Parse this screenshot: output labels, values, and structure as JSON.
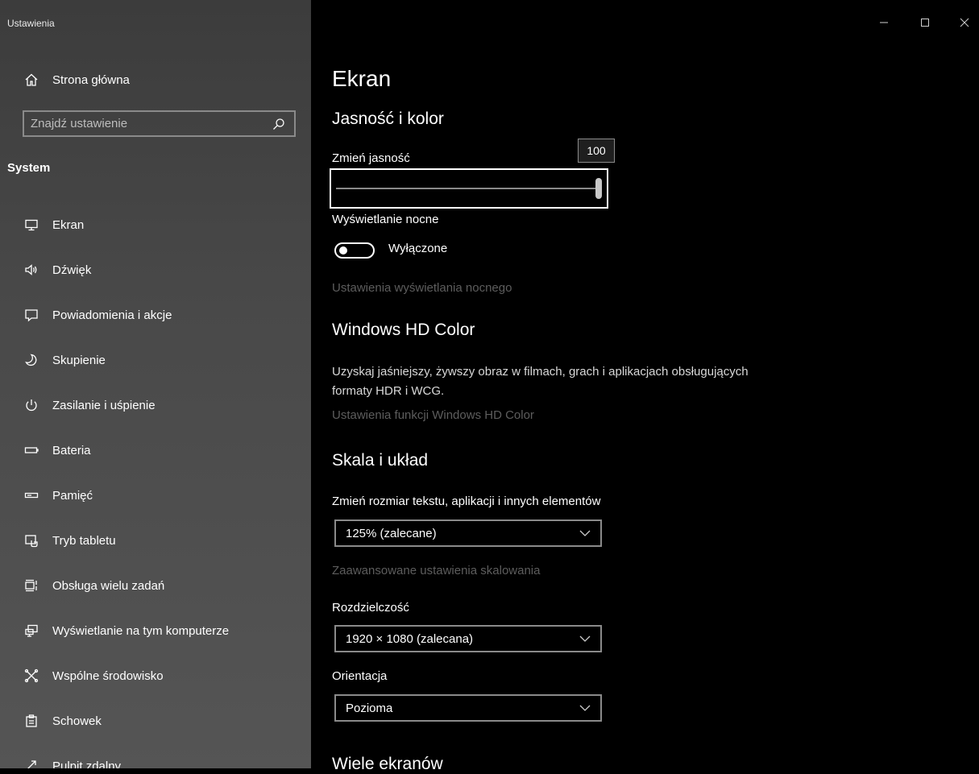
{
  "window": {
    "title": "Ustawienia"
  },
  "sidebar": {
    "home_label": "Strona główna",
    "search_placeholder": "Znajdź ustawienie",
    "section_title": "System",
    "items": [
      {
        "label": "Ekran",
        "icon": "monitor-icon"
      },
      {
        "label": "Dźwięk",
        "icon": "speaker-icon"
      },
      {
        "label": "Powiadomienia i akcje",
        "icon": "notification-icon"
      },
      {
        "label": "Skupienie",
        "icon": "moon-icon"
      },
      {
        "label": "Zasilanie i uśpienie",
        "icon": "power-icon"
      },
      {
        "label": "Bateria",
        "icon": "battery-icon"
      },
      {
        "label": "Pamięć",
        "icon": "storage-icon"
      },
      {
        "label": "Tryb tabletu",
        "icon": "tablet-mode-icon"
      },
      {
        "label": "Obsługa wielu zadań",
        "icon": "multitasking-icon"
      },
      {
        "label": "Wyświetlanie na tym komputerze",
        "icon": "project-icon"
      },
      {
        "label": "Wspólne środowisko",
        "icon": "shared-experiences-icon"
      },
      {
        "label": "Schowek",
        "icon": "clipboard-icon"
      },
      {
        "label": "Pulpit zdalny",
        "icon": "remote-desktop-icon"
      }
    ]
  },
  "main": {
    "page_title": "Ekran",
    "brightness": {
      "heading": "Jasność i kolor",
      "label": "Zmień jasność",
      "value": "100",
      "level_percent": 100
    },
    "night_light": {
      "label": "Wyświetlanie nocne",
      "state": "Wyłączone",
      "settings_link": "Ustawienia wyświetlania nocnego"
    },
    "hd_color": {
      "heading": "Windows HD Color",
      "description": "Uzyskaj jaśniejszy, żywszy obraz w filmach, grach i aplikacjach obsługujących formaty HDR i WCG.",
      "settings_link": "Ustawienia funkcji Windows HD Color"
    },
    "scale": {
      "heading": "Skala i układ",
      "size_label": "Zmień rozmiar tekstu, aplikacji i innych elementów",
      "size_value": "125% (zalecane)",
      "advanced_link": "Zaawansowane ustawienia skalowania",
      "resolution_label": "Rozdzielczość",
      "resolution_value": "1920 × 1080 (zalecana)",
      "orientation_label": "Orientacja",
      "orientation_value": "Pozioma"
    },
    "multiple_displays": {
      "heading": "Wiele ekranów"
    }
  }
}
